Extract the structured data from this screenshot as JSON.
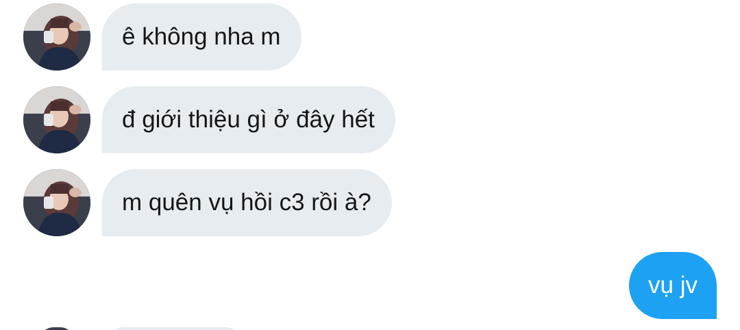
{
  "conversation": {
    "messages": [
      {
        "direction": "incoming",
        "text": "ê không nha m",
        "avatar_icon": "user-avatar"
      },
      {
        "direction": "incoming",
        "text": "đ giới thiệu gì ở đây hết",
        "avatar_icon": "user-avatar"
      },
      {
        "direction": "incoming",
        "text": "m quên vụ hồi c3 rồi à?",
        "avatar_icon": "user-avatar"
      },
      {
        "direction": "outgoing",
        "text": "vụ jv"
      }
    ],
    "colors": {
      "incoming_bubble": "#e6ecf0",
      "incoming_text": "#14171a",
      "outgoing_bubble": "#1da1f2",
      "outgoing_text": "#ffffff",
      "background": "#ffffff"
    }
  }
}
